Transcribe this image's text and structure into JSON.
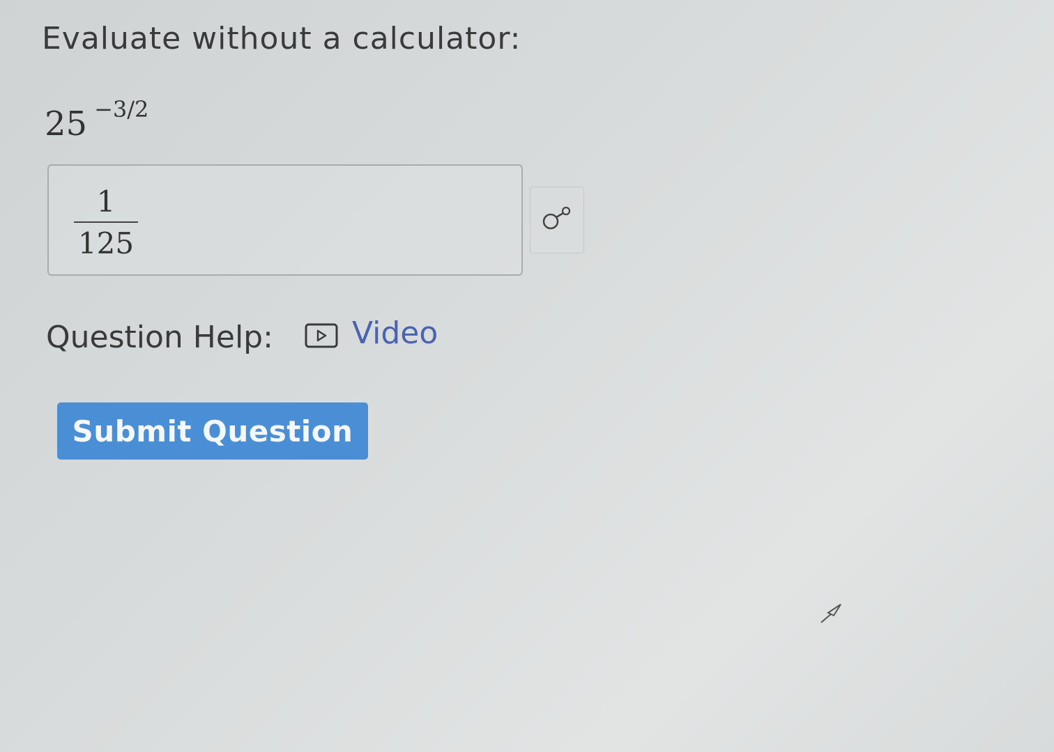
{
  "prompt": "Evaluate without a calculator:",
  "expression": {
    "base": "25",
    "exponent": "−3/2"
  },
  "answer": {
    "numerator": "1",
    "denominator": "125"
  },
  "preview_button": {
    "icon": "eye-glasses-icon"
  },
  "help": {
    "label": "Question Help:",
    "video_label": "Video",
    "video_icon": "play-box-icon",
    "link_color": "#4a63b0"
  },
  "submit": {
    "label": "Submit Question",
    "color": "#4a8fd6"
  }
}
